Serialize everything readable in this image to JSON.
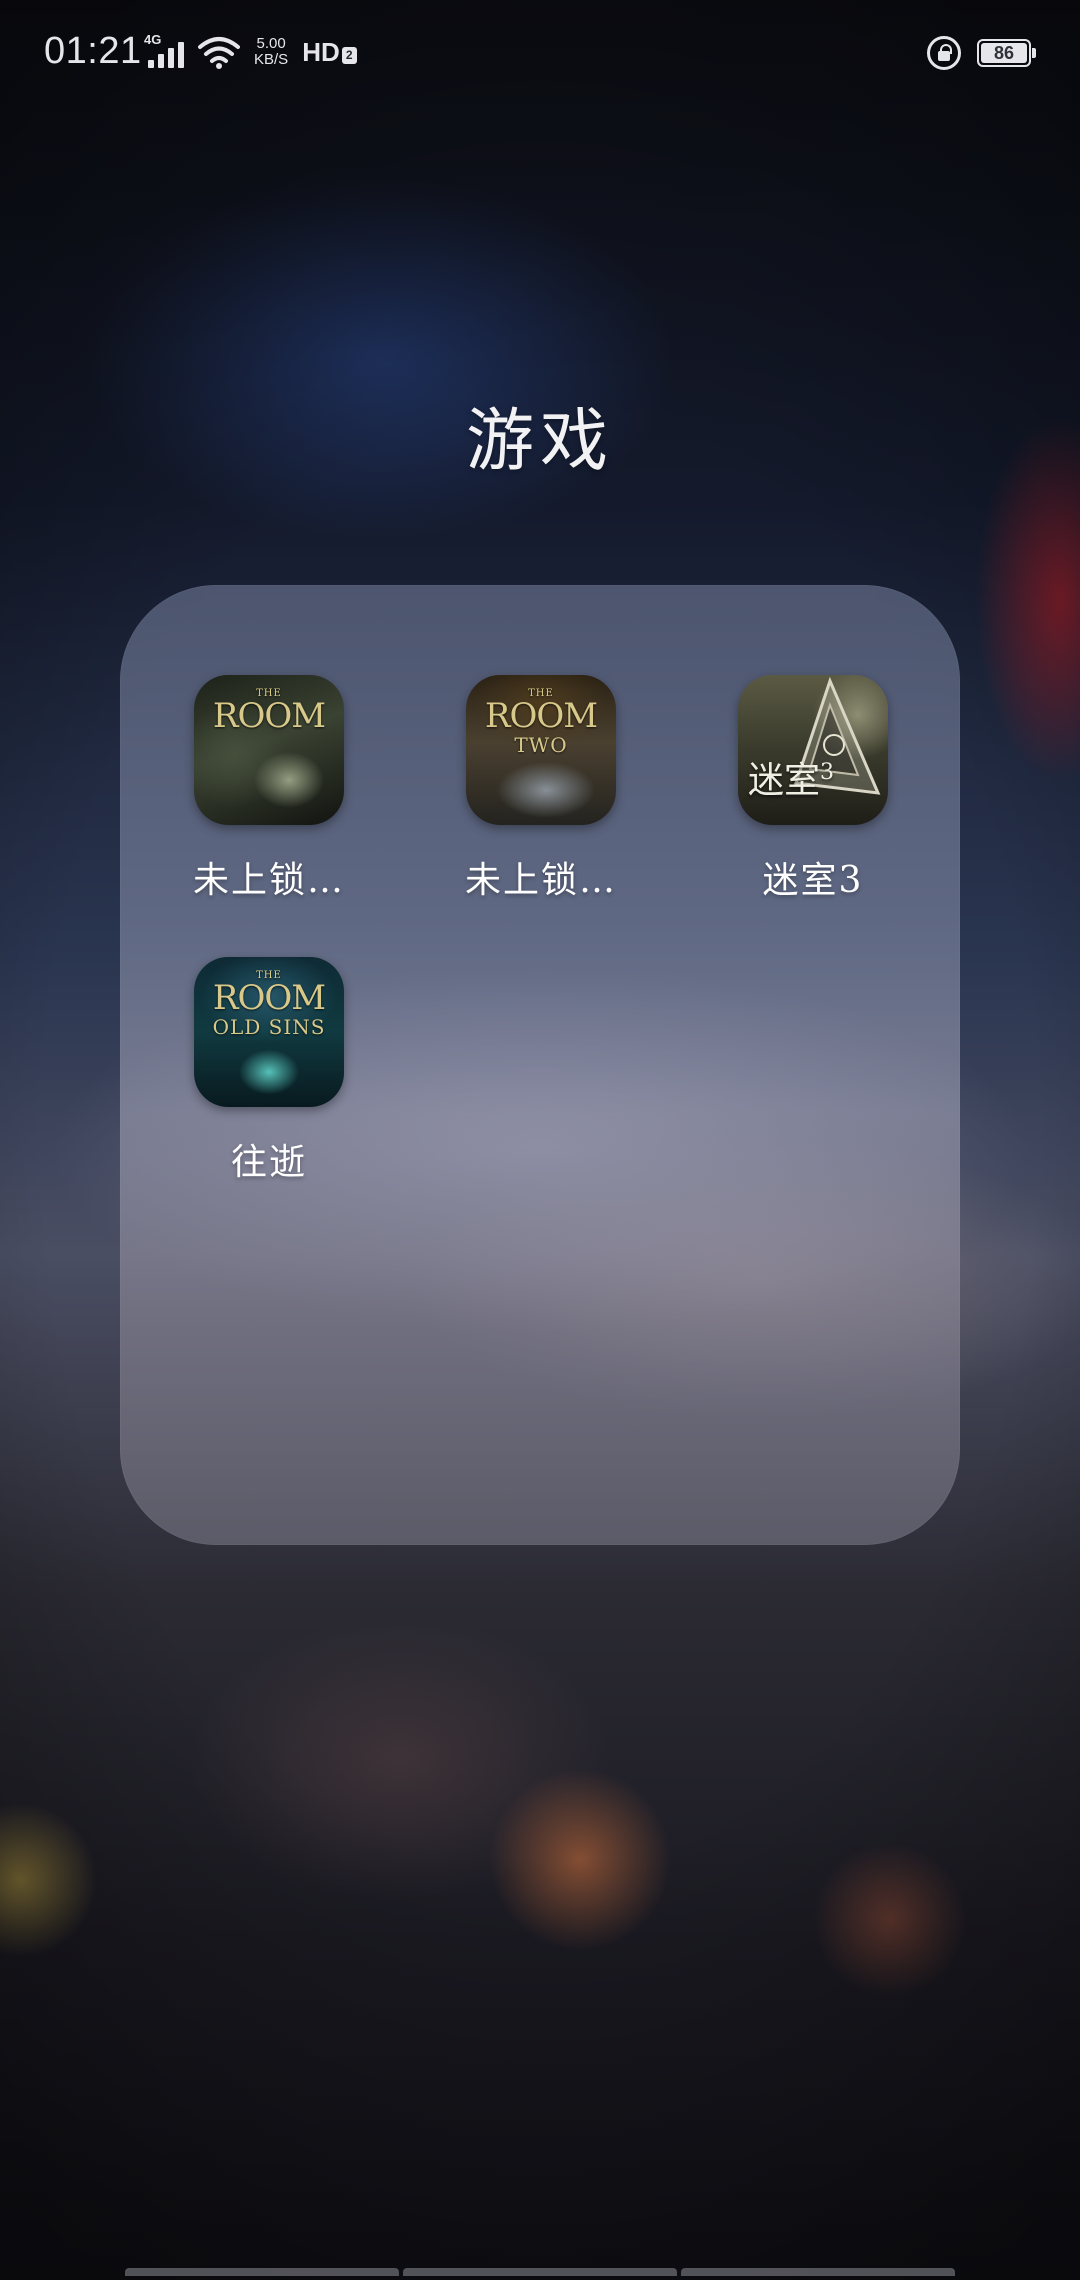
{
  "status_bar": {
    "time": "01:21",
    "network_type": "4G",
    "net_speed_value": "5.00",
    "net_speed_unit": "KB/S",
    "hd_label": "HD",
    "hd_sub": "2",
    "battery_level": "86",
    "icons": [
      "signal-icon",
      "wifi-icon",
      "hd-voice-icon",
      "rotation-lock-icon",
      "battery-icon"
    ]
  },
  "folder": {
    "title": "游戏",
    "apps": [
      {
        "label": "未上锁…",
        "icon": "the-room-icon",
        "logo_the": "THE",
        "logo_big": "ROOM",
        "logo_small": ""
      },
      {
        "label": "未上锁…",
        "icon": "the-room-two-icon",
        "logo_the": "THE",
        "logo_big": "ROOM",
        "logo_small": "TWO"
      },
      {
        "label": "迷室3",
        "icon": "the-room-three-icon",
        "logo_text": "迷室",
        "logo_sup": "3"
      },
      {
        "label": "往逝",
        "icon": "the-room-old-sins-icon",
        "logo_the": "THE",
        "logo_big": "ROOM",
        "logo_small": "OLD SINS"
      }
    ]
  }
}
